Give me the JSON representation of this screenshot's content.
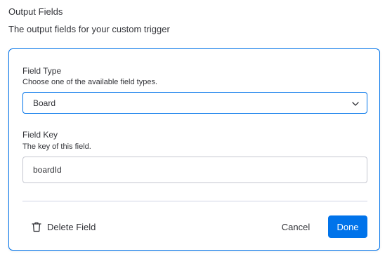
{
  "section": {
    "title": "Output Fields",
    "description": "The output fields for your custom trigger"
  },
  "field_type": {
    "label": "Field Type",
    "help": "Choose one of the available field types.",
    "selected": "Board"
  },
  "field_key": {
    "label": "Field Key",
    "help": "The key of this field.",
    "value": "boardId"
  },
  "actions": {
    "delete_label": "Delete Field",
    "cancel_label": "Cancel",
    "done_label": "Done"
  },
  "icons": {
    "select_arrow": "chevron-down-icon",
    "delete": "trash-icon"
  },
  "colors": {
    "accent": "#0073ea",
    "text": "#323338",
    "border": "#c5c7d0"
  }
}
